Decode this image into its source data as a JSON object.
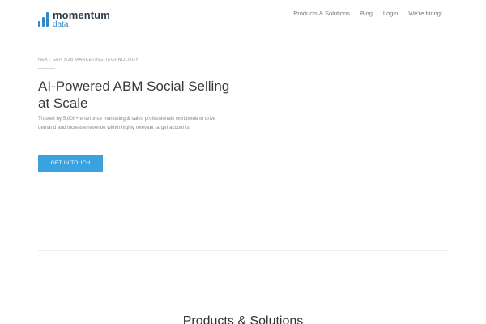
{
  "brand": {
    "word1": "momentum",
    "word2": "data",
    "logo_icon": "bar-chart-icon",
    "accent_color": "#2f89c8"
  },
  "nav": {
    "items": [
      {
        "label": "Products & Solutions"
      },
      {
        "label": "Blog"
      },
      {
        "label": "Login"
      },
      {
        "label": "We're hiring!"
      }
    ]
  },
  "hero": {
    "eyebrow": "NEXT GEN B2B MARKETING TECHNOLOGY",
    "title": "AI-Powered ABM Social Selling at Scale",
    "subtitle": "Trusted by 5,000+ enterprise marketing & sales professionals worldwide to drive demand and increase revenue within highly relevant target accounts.",
    "cta_label": "GET IN TOUCH",
    "cta_color": "#3aa3df"
  },
  "sections": {
    "products_title": "Products & Solutions"
  }
}
